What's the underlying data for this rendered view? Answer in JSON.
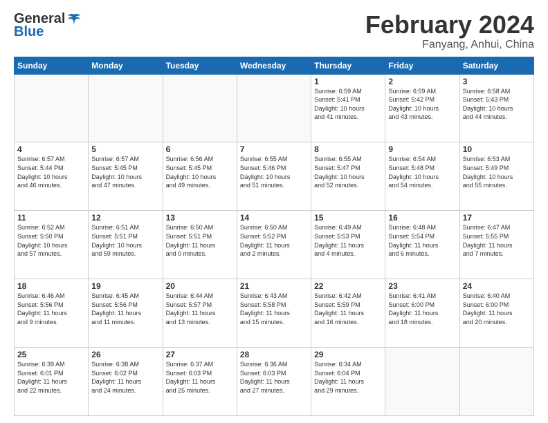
{
  "header": {
    "logo": {
      "general": "General",
      "blue": "Blue"
    },
    "month": "February 2024",
    "location": "Fanyang, Anhui, China"
  },
  "weekdays": [
    "Sunday",
    "Monday",
    "Tuesday",
    "Wednesday",
    "Thursday",
    "Friday",
    "Saturday"
  ],
  "weeks": [
    [
      {
        "day": "",
        "info": ""
      },
      {
        "day": "",
        "info": ""
      },
      {
        "day": "",
        "info": ""
      },
      {
        "day": "",
        "info": ""
      },
      {
        "day": "1",
        "info": "Sunrise: 6:59 AM\nSunset: 5:41 PM\nDaylight: 10 hours\nand 41 minutes."
      },
      {
        "day": "2",
        "info": "Sunrise: 6:59 AM\nSunset: 5:42 PM\nDaylight: 10 hours\nand 43 minutes."
      },
      {
        "day": "3",
        "info": "Sunrise: 6:58 AM\nSunset: 5:43 PM\nDaylight: 10 hours\nand 44 minutes."
      }
    ],
    [
      {
        "day": "4",
        "info": "Sunrise: 6:57 AM\nSunset: 5:44 PM\nDaylight: 10 hours\nand 46 minutes."
      },
      {
        "day": "5",
        "info": "Sunrise: 6:57 AM\nSunset: 5:45 PM\nDaylight: 10 hours\nand 47 minutes."
      },
      {
        "day": "6",
        "info": "Sunrise: 6:56 AM\nSunset: 5:45 PM\nDaylight: 10 hours\nand 49 minutes."
      },
      {
        "day": "7",
        "info": "Sunrise: 6:55 AM\nSunset: 5:46 PM\nDaylight: 10 hours\nand 51 minutes."
      },
      {
        "day": "8",
        "info": "Sunrise: 6:55 AM\nSunset: 5:47 PM\nDaylight: 10 hours\nand 52 minutes."
      },
      {
        "day": "9",
        "info": "Sunrise: 6:54 AM\nSunset: 5:48 PM\nDaylight: 10 hours\nand 54 minutes."
      },
      {
        "day": "10",
        "info": "Sunrise: 6:53 AM\nSunset: 5:49 PM\nDaylight: 10 hours\nand 55 minutes."
      }
    ],
    [
      {
        "day": "11",
        "info": "Sunrise: 6:52 AM\nSunset: 5:50 PM\nDaylight: 10 hours\nand 57 minutes."
      },
      {
        "day": "12",
        "info": "Sunrise: 6:51 AM\nSunset: 5:51 PM\nDaylight: 10 hours\nand 59 minutes."
      },
      {
        "day": "13",
        "info": "Sunrise: 6:50 AM\nSunset: 5:51 PM\nDaylight: 11 hours\nand 0 minutes."
      },
      {
        "day": "14",
        "info": "Sunrise: 6:50 AM\nSunset: 5:52 PM\nDaylight: 11 hours\nand 2 minutes."
      },
      {
        "day": "15",
        "info": "Sunrise: 6:49 AM\nSunset: 5:53 PM\nDaylight: 11 hours\nand 4 minutes."
      },
      {
        "day": "16",
        "info": "Sunrise: 6:48 AM\nSunset: 5:54 PM\nDaylight: 11 hours\nand 6 minutes."
      },
      {
        "day": "17",
        "info": "Sunrise: 6:47 AM\nSunset: 5:55 PM\nDaylight: 11 hours\nand 7 minutes."
      }
    ],
    [
      {
        "day": "18",
        "info": "Sunrise: 6:46 AM\nSunset: 5:56 PM\nDaylight: 11 hours\nand 9 minutes."
      },
      {
        "day": "19",
        "info": "Sunrise: 6:45 AM\nSunset: 5:56 PM\nDaylight: 11 hours\nand 11 minutes."
      },
      {
        "day": "20",
        "info": "Sunrise: 6:44 AM\nSunset: 5:57 PM\nDaylight: 11 hours\nand 13 minutes."
      },
      {
        "day": "21",
        "info": "Sunrise: 6:43 AM\nSunset: 5:58 PM\nDaylight: 11 hours\nand 15 minutes."
      },
      {
        "day": "22",
        "info": "Sunrise: 6:42 AM\nSunset: 5:59 PM\nDaylight: 11 hours\nand 16 minutes."
      },
      {
        "day": "23",
        "info": "Sunrise: 6:41 AM\nSunset: 6:00 PM\nDaylight: 11 hours\nand 18 minutes."
      },
      {
        "day": "24",
        "info": "Sunrise: 6:40 AM\nSunset: 6:00 PM\nDaylight: 11 hours\nand 20 minutes."
      }
    ],
    [
      {
        "day": "25",
        "info": "Sunrise: 6:39 AM\nSunset: 6:01 PM\nDaylight: 11 hours\nand 22 minutes."
      },
      {
        "day": "26",
        "info": "Sunrise: 6:38 AM\nSunset: 6:02 PM\nDaylight: 11 hours\nand 24 minutes."
      },
      {
        "day": "27",
        "info": "Sunrise: 6:37 AM\nSunset: 6:03 PM\nDaylight: 11 hours\nand 25 minutes."
      },
      {
        "day": "28",
        "info": "Sunrise: 6:36 AM\nSunset: 6:03 PM\nDaylight: 11 hours\nand 27 minutes."
      },
      {
        "day": "29",
        "info": "Sunrise: 6:34 AM\nSunset: 6:04 PM\nDaylight: 11 hours\nand 29 minutes."
      },
      {
        "day": "",
        "info": ""
      },
      {
        "day": "",
        "info": ""
      }
    ]
  ]
}
